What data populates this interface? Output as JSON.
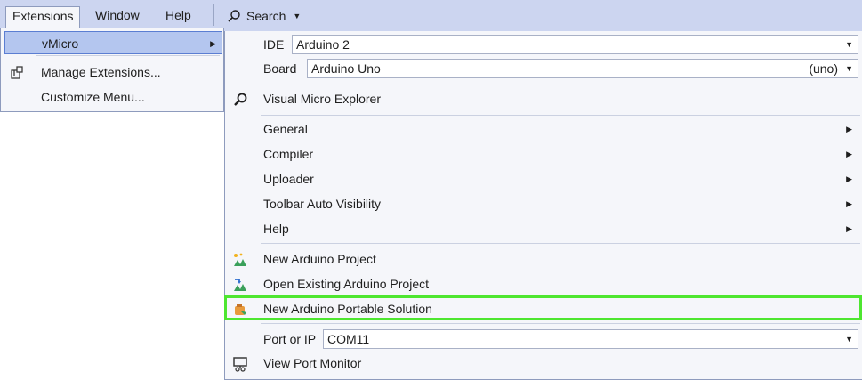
{
  "menubar": {
    "items": [
      {
        "label": "Extensions",
        "active": true
      },
      {
        "label": "Window"
      },
      {
        "label": "Help"
      }
    ],
    "search_label": "Search",
    "search_icon": "search-icon"
  },
  "extensions_menu": {
    "items": [
      {
        "label": "vMicro",
        "has_submenu": true,
        "selected": true
      },
      {
        "label": "Manage Extensions...",
        "icon": "extensions-icon"
      },
      {
        "label": "Customize Menu..."
      }
    ]
  },
  "vmicro_menu": {
    "ide": {
      "label": "IDE",
      "value": "Arduino 2"
    },
    "board": {
      "label": "Board",
      "value": "Arduino Uno",
      "suffix": "(uno)"
    },
    "explorer": {
      "label": "Visual Micro Explorer",
      "icon": "explorer-search-icon"
    },
    "submenus": [
      "General",
      "Compiler",
      "Uploader",
      "Toolbar Auto Visibility",
      "Help"
    ],
    "projects": [
      {
        "label": "New Arduino Project",
        "icon": "new-project-icon"
      },
      {
        "label": "Open Existing Arduino Project",
        "icon": "open-project-icon"
      },
      {
        "label": "New Arduino Portable Solution",
        "icon": "portable-solution-icon",
        "highlighted": true
      }
    ],
    "port": {
      "label": "Port or IP",
      "value": "COM11"
    },
    "monitor": {
      "label": "View Port Monitor",
      "icon": "port-monitor-icon"
    }
  },
  "colors": {
    "menubar_bg": "#ccd5f0",
    "menu_bg": "#f5f6fa",
    "selected_bg": "#b4c6ef",
    "highlight_border": "#4ee630"
  }
}
